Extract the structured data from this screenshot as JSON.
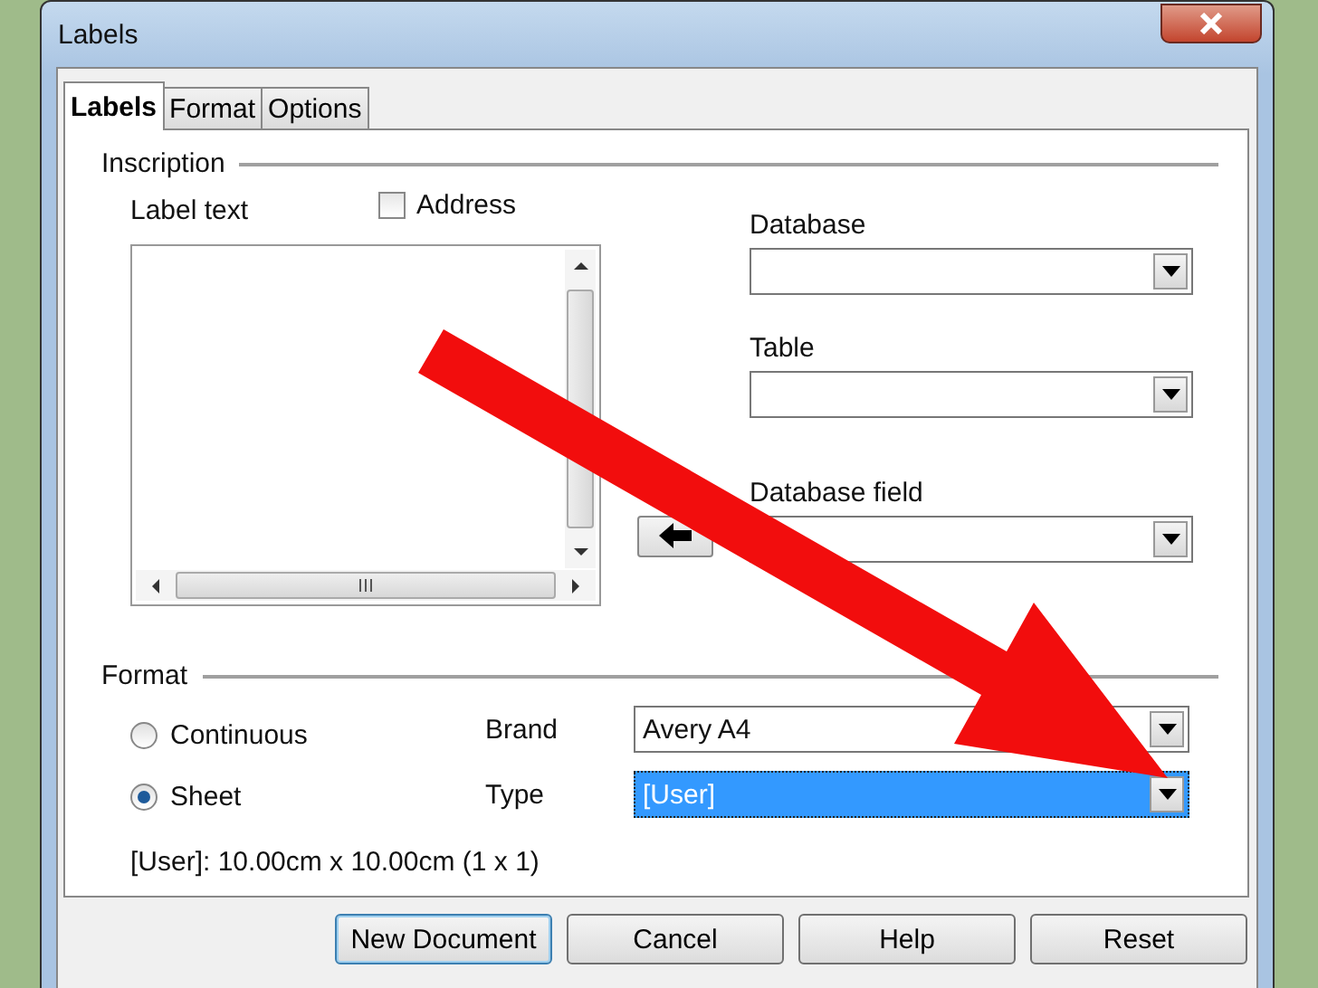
{
  "window": {
    "title": "Labels"
  },
  "tabs": [
    {
      "label": "Labels",
      "selected": true
    },
    {
      "label": "Format",
      "selected": false
    },
    {
      "label": "Options",
      "selected": false
    }
  ],
  "inscription": {
    "heading": "Inscription",
    "label_text": "Label text",
    "address": {
      "label": "Address",
      "checked": false
    },
    "fields": [
      {
        "label": "Database"
      },
      {
        "label": "Table"
      },
      {
        "label": "Database field"
      }
    ]
  },
  "format": {
    "heading": "Format",
    "options": [
      {
        "label": "Continuous",
        "selected": false
      },
      {
        "label": "Sheet",
        "selected": true
      }
    ],
    "brand": {
      "label": "Brand",
      "value": "Avery A4",
      "highlighted": false
    },
    "type": {
      "label": "Type",
      "value": "[User]",
      "highlighted": true
    },
    "info": "[User]: 10.00cm x 10.00cm (1 x 1)"
  },
  "buttons": [
    {
      "label": "New Document",
      "default": true
    },
    {
      "label": "Cancel",
      "default": false
    },
    {
      "label": "Help",
      "default": false
    },
    {
      "label": "Reset",
      "default": false
    }
  ]
}
